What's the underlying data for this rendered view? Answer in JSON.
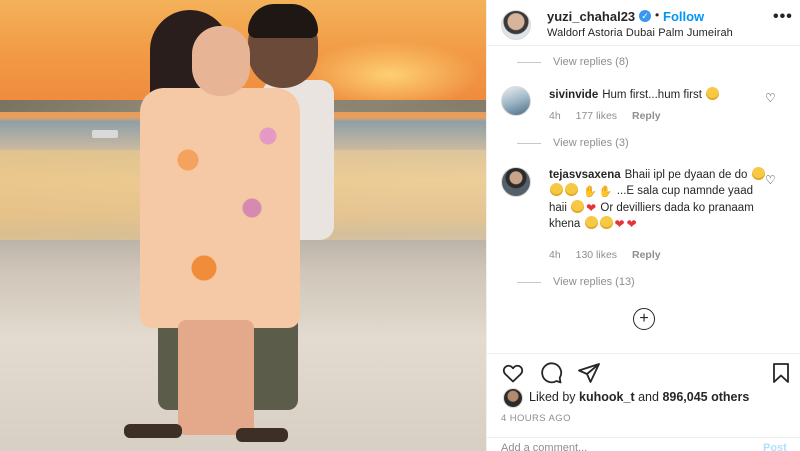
{
  "post": {
    "username": "yuzi_chahal23",
    "verified_icon": "verified-badge-icon",
    "follow_label": "Follow",
    "location": "Waldorf Astoria Dubai Palm Jumeirah",
    "more_label": "•••"
  },
  "comments": {
    "view_replies_1": "View replies (8)",
    "items": [
      {
        "username": "sivinvide",
        "text": "Hum first...hum first",
        "age": "4h",
        "likes": "177 likes",
        "reply_label": "Reply",
        "view_replies": "View replies (3)"
      },
      {
        "username": "tejasvsaxena",
        "text_a": "Bhaii ipl pe dyaan de do",
        "text_b": "...E sala cup namnde yaad haii",
        "text_c": "Or devilliers dada ko pranaam khena",
        "age": "4h",
        "likes": "130 likes",
        "reply_label": "Reply",
        "view_replies": "View replies (13)"
      }
    ],
    "load_more_icon": "plus-circle-icon"
  },
  "actions": {
    "liked_by_prefix": "Liked by",
    "liked_by_user": "kuhook_t",
    "and": "and",
    "others": "896,045 others",
    "timestamp": "4 HOURS AGO",
    "add_comment_placeholder": "Add a comment...",
    "post_label": "Post"
  },
  "colors": {
    "accent": "#0095f6",
    "muted": "#8e8e8e",
    "heart": "#e8323a"
  }
}
